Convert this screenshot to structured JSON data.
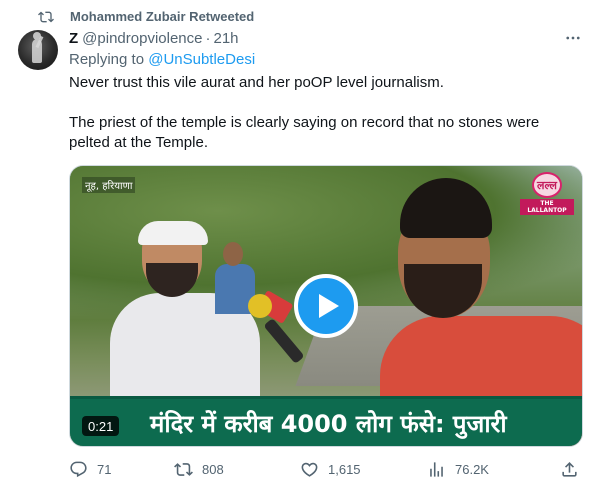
{
  "retweet_bar": {
    "text": "Mohammed Zubair Retweeted",
    "icon": "retweet-icon"
  },
  "tweet": {
    "display_name": "Z",
    "handle": "@pindropviolence",
    "separator": "·",
    "time": "21h",
    "reply_prefix": "Replying to",
    "reply_mention": "@UnSubtleDesi",
    "text_line1": "Never trust this vile aurat and her poOP level journalism.",
    "text_line2": "The priest of the temple is clearly saying on record that no stones were pelted at the Temple."
  },
  "media": {
    "location_tag": "नूह, हरियाणा",
    "brand_logo_text": "लल्ल",
    "brand_name": "THE LALLANTOP",
    "caption": "मंदिर में करीब 4000 लोग फंसे: पुजारी",
    "duration": "0:21",
    "play_icon": "play-icon"
  },
  "actions": {
    "replies": "71",
    "retweets": "808",
    "likes": "1,615",
    "views": "76.2K"
  },
  "colors": {
    "accent": "#1d9bf0",
    "secondary_text": "#536471",
    "primary_text": "#0f1419",
    "caption_bg": "#0d6b4f",
    "brand": "#c21a5b"
  }
}
